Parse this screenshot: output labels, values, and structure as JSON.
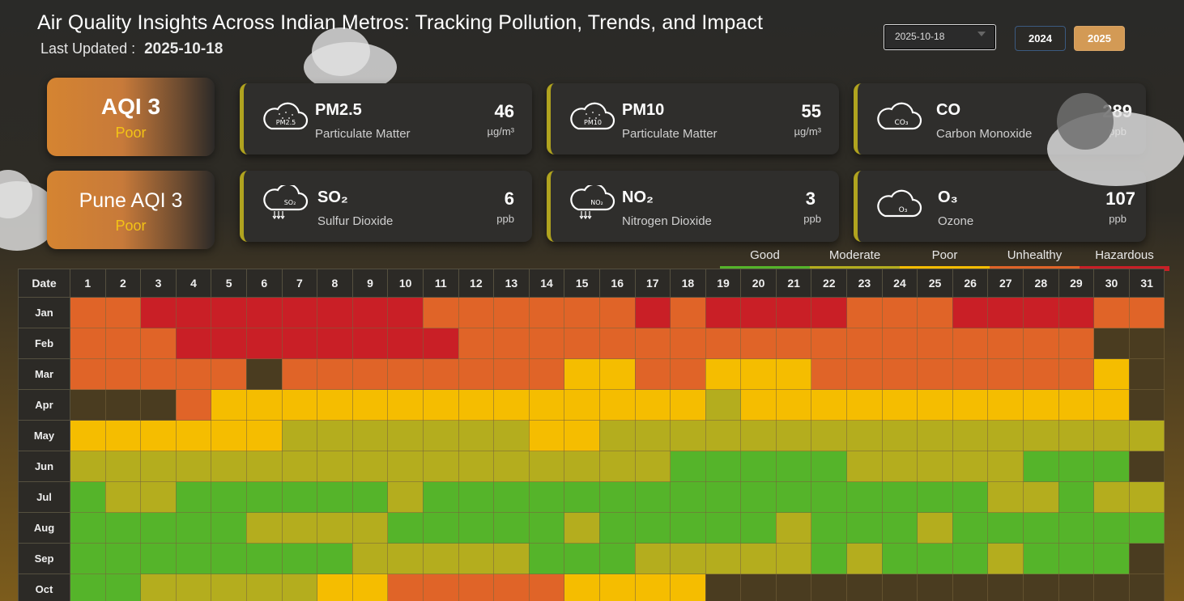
{
  "header": {
    "title": "Air Quality Insights Across Indian Metros: Tracking Pollution, Trends, and Impact",
    "updated_label": "Last Updated :",
    "updated_value": "2025-10-18"
  },
  "controls": {
    "date_value": "2025-10-18",
    "years": [
      "2024",
      "2025"
    ],
    "active_year": "2025"
  },
  "summary": {
    "aqi_main": "AQI 3",
    "aqi_main_level": "Poor",
    "aqi_city": "Pune AQI 3",
    "aqi_city_level": "Poor"
  },
  "pollutants": [
    {
      "icon": "PM2.5",
      "name": "PM2.5",
      "desc": "Particulate Matter",
      "value": "46",
      "unit": "µg/m³"
    },
    {
      "icon": "PM10",
      "name": "PM10",
      "desc": "Particulate Matter",
      "value": "55",
      "unit": "µg/m³"
    },
    {
      "icon": "CO₃",
      "name": "CO",
      "desc": "Carbon Monoxide",
      "value": "289",
      "unit": "ppb"
    },
    {
      "icon": "SO₂",
      "name": "SO₂",
      "desc": "Sulfur Dioxide",
      "value": "6",
      "unit": "ppb"
    },
    {
      "icon": "NO₂",
      "name": "NO₂",
      "desc": "Nitrogen Dioxide",
      "value": "3",
      "unit": "ppb"
    },
    {
      "icon": "O₃",
      "name": "O₃",
      "desc": "Ozone",
      "value": "107",
      "unit": "ppb"
    }
  ],
  "legend": [
    "Good",
    "Moderate",
    "Poor",
    "Unhealthy",
    "Hazardous"
  ],
  "level_colors": {
    "G": "#55b42a",
    "M": "#b4ad1e",
    "P": "#f5bd00",
    "U": "#e06428",
    "H": "#c91f26",
    "-": "#4a3c20"
  },
  "calendar": {
    "date_header": "Date",
    "days": [
      "1",
      "2",
      "3",
      "4",
      "5",
      "6",
      "7",
      "8",
      "9",
      "10",
      "11",
      "12",
      "13",
      "14",
      "15",
      "16",
      "17",
      "18",
      "19",
      "20",
      "21",
      "22",
      "23",
      "24",
      "25",
      "26",
      "27",
      "28",
      "29",
      "30",
      "31"
    ],
    "months": [
      {
        "label": "Jan",
        "levels": "UUHHHHHHHHUUUUUUHUHHHHUUUHHHHUU"
      },
      {
        "label": "Feb",
        "levels": "UUUHHHHHHHHUUUUUUUUUUUUUUUUUU--"
      },
      {
        "label": "Mar",
        "levels": "UUUUU-UUUUUUUUPPUUPPPUUUUUUUUP-"
      },
      {
        "label": "Apr",
        "levels": "---UPPPPPPPPPPPPPPMPPPPPPPPPPP-"
      },
      {
        "label": "May",
        "levels": "PPPPPPMMMMMMMPPMMMMMMMMMMMMMMMM"
      },
      {
        "label": "Jun",
        "levels": "MMMMMMMMMMMMMMMMMGGGGGMMMMMGGG-"
      },
      {
        "label": "Jul",
        "levels": "GMMGGGGGGMGGGGGGGGGGGGGGGGMMGMM"
      },
      {
        "label": "Aug",
        "levels": "GGGGGMMMMGGGGGMGGGGGMGGGMGGGGGG"
      },
      {
        "label": "Sep",
        "levels": "GGGGGGGGMMMMMGGGMMMMMGMGGGMGGG-"
      },
      {
        "label": "Oct",
        "levels": "GGMMMMMPPUUUUUPPPP-------------"
      }
    ]
  }
}
